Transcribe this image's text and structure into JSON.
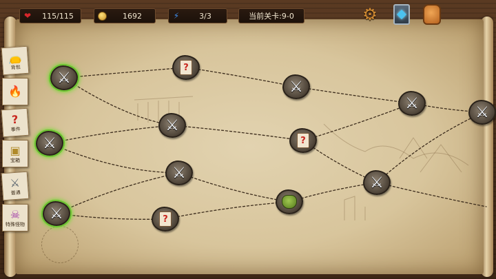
{
  "hud": {
    "hp": "115/115",
    "gold": "1692",
    "energy": "3/3",
    "level": "当前关卡:9-0"
  },
  "top_icons": [
    "gear-icon",
    "card-deck-icon",
    "backpack-icon"
  ],
  "sidebar": {
    "items": [
      {
        "icon": "pouch-icon",
        "label": "背包"
      },
      {
        "icon": "campfire-icon",
        "label": ""
      },
      {
        "icon": "question-card-icon",
        "label": "事件"
      },
      {
        "icon": "treasure-chest-icon",
        "label": "宝箱"
      },
      {
        "icon": "crossed-swords-icon",
        "label": "普通"
      },
      {
        "icon": "demon-icon",
        "label": "特殊怪物"
      }
    ]
  },
  "map": {
    "nodes": [
      {
        "type": "battle",
        "state": "available"
      },
      {
        "type": "battle",
        "state": "available"
      },
      {
        "type": "battle",
        "state": "available"
      },
      {
        "type": "event",
        "state": "locked"
      },
      {
        "type": "battle",
        "state": "locked"
      },
      {
        "type": "battle",
        "state": "locked"
      },
      {
        "type": "event",
        "state": "locked"
      },
      {
        "type": "event",
        "state": "locked"
      },
      {
        "type": "battle",
        "state": "locked"
      },
      {
        "type": "battle",
        "state": "locked"
      },
      {
        "type": "treasure",
        "state": "locked"
      },
      {
        "type": "battle",
        "state": "locked"
      },
      {
        "type": "battle",
        "state": "locked"
      }
    ]
  },
  "colors": {
    "active_glow": "#7bd83a",
    "parchment": "#d8c59c",
    "wood": "#4a2f1b",
    "hp_heart": "#d8262b",
    "energy": "#3f8ff0"
  }
}
